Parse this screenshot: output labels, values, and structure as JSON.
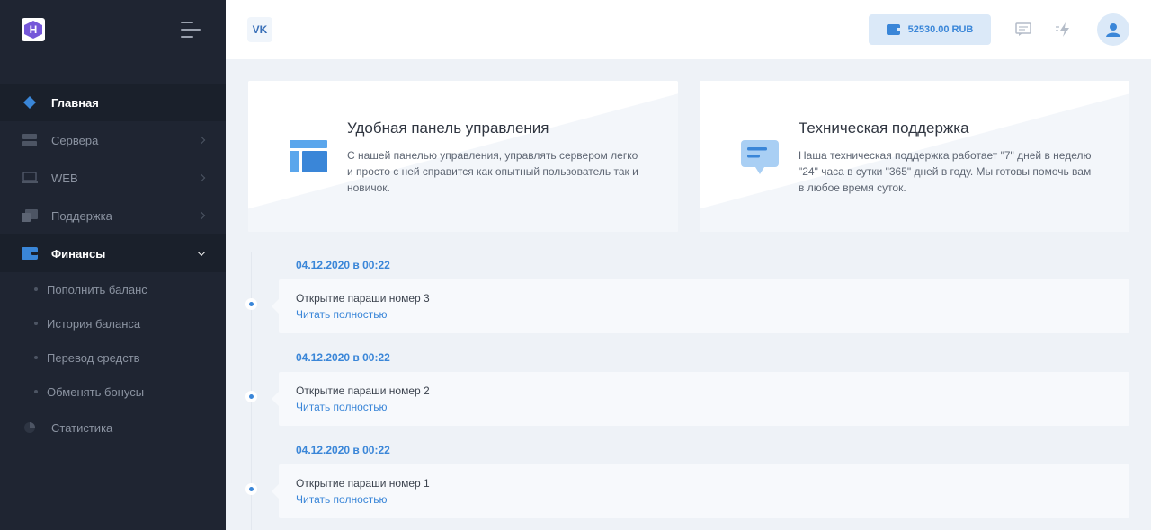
{
  "sidebar": {
    "logo_letter": "H",
    "items": [
      {
        "label": "Главная",
        "icon": "diamond-icon"
      },
      {
        "label": "Сервера",
        "icon": "server-icon"
      },
      {
        "label": "WEB",
        "icon": "laptop-icon"
      },
      {
        "label": "Поддержка",
        "icon": "support-icon"
      },
      {
        "label": "Финансы",
        "icon": "wallet-icon"
      },
      {
        "label": "Статистика",
        "icon": "pie-chart-icon"
      }
    ],
    "finance_sub": [
      {
        "label": "Пополнить баланс"
      },
      {
        "label": "История баланса"
      },
      {
        "label": "Перевод средств"
      },
      {
        "label": "Обменять бонусы"
      }
    ]
  },
  "topbar": {
    "vk_label": "VK",
    "balance": "52530.00 RUB"
  },
  "cards": [
    {
      "title": "Удобная панель управления",
      "text": "С нашей панелью управления, управлять сервером легко и просто с ней справится как опытный пользователь так и новичок.",
      "icon": "layout-icon"
    },
    {
      "title": "Техническая поддержка",
      "text": "Наша техническая поддержка работает \"7\" дней в неделю \"24\" часа в сутки \"365\" дней в году. Мы готовы помочь вам в любое время суток.",
      "icon": "chat-icon"
    }
  ],
  "timeline": [
    {
      "date": "04.12.2020 в 00:22",
      "title": "Открытие параши номер 3",
      "link": "Читать полностью"
    },
    {
      "date": "04.12.2020 в 00:22",
      "title": "Открытие параши номер 2",
      "link": "Читать полностью"
    },
    {
      "date": "04.12.2020 в 00:22",
      "title": "Открытие параши номер 1",
      "link": "Читать полностью"
    }
  ],
  "colors": {
    "sidebar_bg": "#1f2532",
    "accent": "#3a86d8",
    "page_bg": "#eef2f7"
  }
}
